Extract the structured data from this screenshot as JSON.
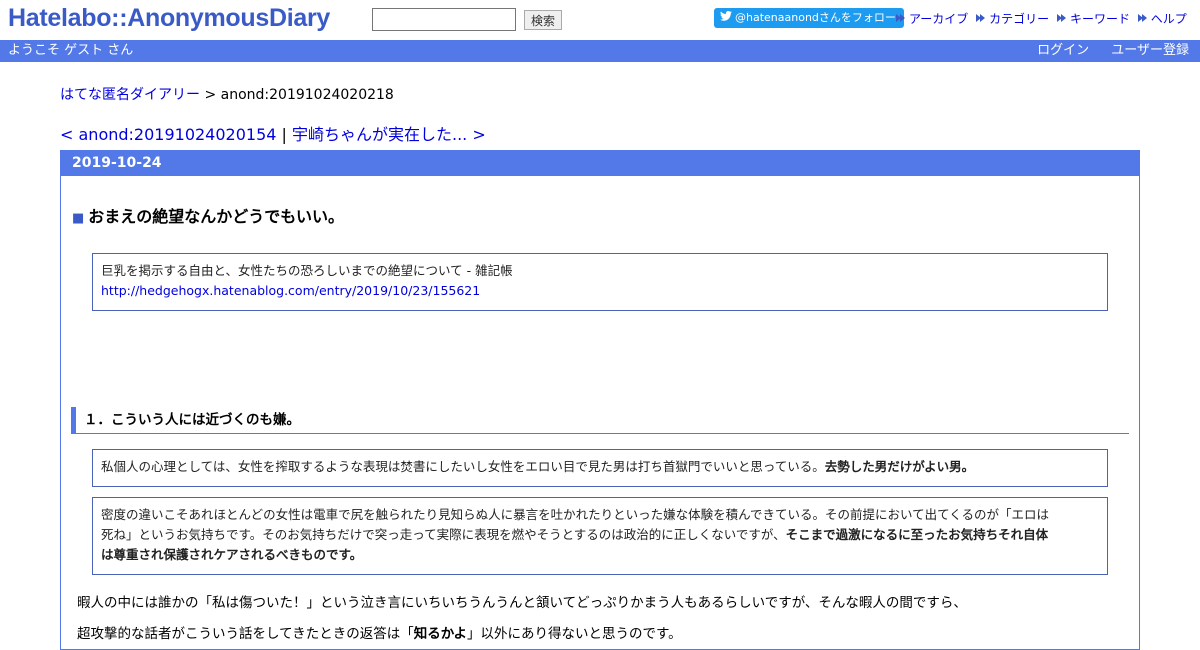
{
  "header": {
    "logo": "Hatelabo::AnonymousDiary",
    "search_placeholder": "",
    "search_button": "検索",
    "twitter_follow": "@hatenaanondさんをフォロー",
    "nav": [
      "アーカイブ",
      "カテゴリー",
      "キーワード",
      "ヘルプ"
    ]
  },
  "bluebar": {
    "welcome": "ようこそ ゲスト さん",
    "login": "ログイン",
    "register": "ユーザー登録"
  },
  "breadcrumb": {
    "home": "はてな匿名ダイアリー",
    "separator": " > ",
    "current": "anond:20191024020218"
  },
  "pager": {
    "prev": "< anond:20191024020154",
    "separator": " | ",
    "next": "宇崎ちゃんが実在した... >"
  },
  "day": {
    "date": "2019-10-24"
  },
  "entry": {
    "title_mark": "■",
    "title": "おまえの絶望なんかどうでもいい。",
    "quote_1": {
      "text": "巨乳を掲示する自由と、女性たちの恐ろしいまでの絶望について - 雑記帳",
      "link": "http://hedgehogx.hatenablog.com/entry/2019/10/23/155621"
    },
    "section_heading": "１．こういう人には近づくのも嫌。",
    "quote_2": {
      "text": "私個人の心理としては、女性を搾取するような表現は焚書にしたいし女性をエロい目で見た男は打ち首獄門でいいと思っている。",
      "bold": "去勢した男だけがよい男。"
    },
    "quote_3": {
      "line1": "密度の違いこそあれほとんどの女性は電車で尻を触られたり見知らぬ人に暴言を吐かれたりといった嫌な体験を積んできている。その前提において出てくるのが「エロは",
      "line2_start": "死ね」というお気持ちです。そのお気持ちだけで突っ走って実際に表現を燃やそうとするのは政治的に正しくないですが、",
      "line2_bold": "そこまで過激になるに至ったお気持ちそれ自体",
      "line3_bold": "は尊重され保護されケアされるべきものです。"
    },
    "para_1": "暇人の中には誰かの「私は傷ついた！」という泣き言にいちいちうんうんと頷いてどっぷりかまう人もあるらしいですが、そんな暇人の間ですら、",
    "para_2_start": "超攻撃的な話者がこういう話をしてきたときの返答は「",
    "para_2_bold": "知るかよ",
    "para_2_end": "」以外にあり得ないと思うのです。"
  },
  "colors": {
    "accent_blue": "#5279e7",
    "logo_blue": "#3a5bc7",
    "link": "#0000de",
    "twitter": "#1d9bf0"
  }
}
